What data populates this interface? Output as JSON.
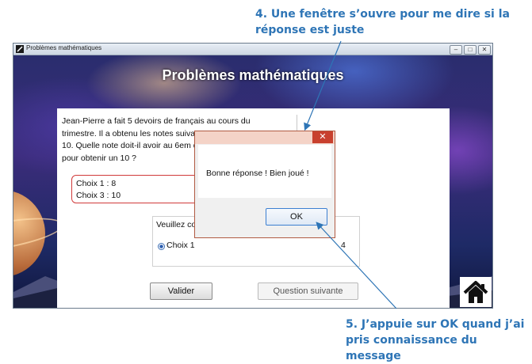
{
  "annotations": {
    "top": "4. Une fenêtre s’ouvre pour me dire si la réponse est juste",
    "bottom": "5. J’appuie sur OK quand j’ai pris connaissance du message"
  },
  "window": {
    "title": "Problèmes mathématiques",
    "app_title": "Problèmes mathématiques"
  },
  "question": {
    "text": "Jean-Pierre a fait 5 devoirs de français au cours du trimestre. Il a obtenu les notes suivantes : 12, 11, 7, 14 et 10. Quelle note doit-il avoir au 6em d'un coefficient 2, pour obtenir un 10 ?"
  },
  "choices": {
    "choice_1": "Choix 1 :  8",
    "choice_3": "Choix 3 : 10"
  },
  "answer_group": {
    "label": "Veuillez co",
    "radio_label": "Choix 1",
    "radio_4_fragment": "4"
  },
  "buttons": {
    "valider": "Valider",
    "suivante": "Question suivante"
  },
  "dialog": {
    "close": "✕",
    "message": "Bonne réponse ! Bien joué !",
    "ok": "OK"
  },
  "colors": {
    "annotation": "#2e75b6",
    "choices_border": "#d03a3a",
    "dialog_close": "#c8402e"
  },
  "icons": [
    "app-icon",
    "home-icon",
    "close-icon",
    "minimize-icon",
    "maximize-icon"
  ]
}
